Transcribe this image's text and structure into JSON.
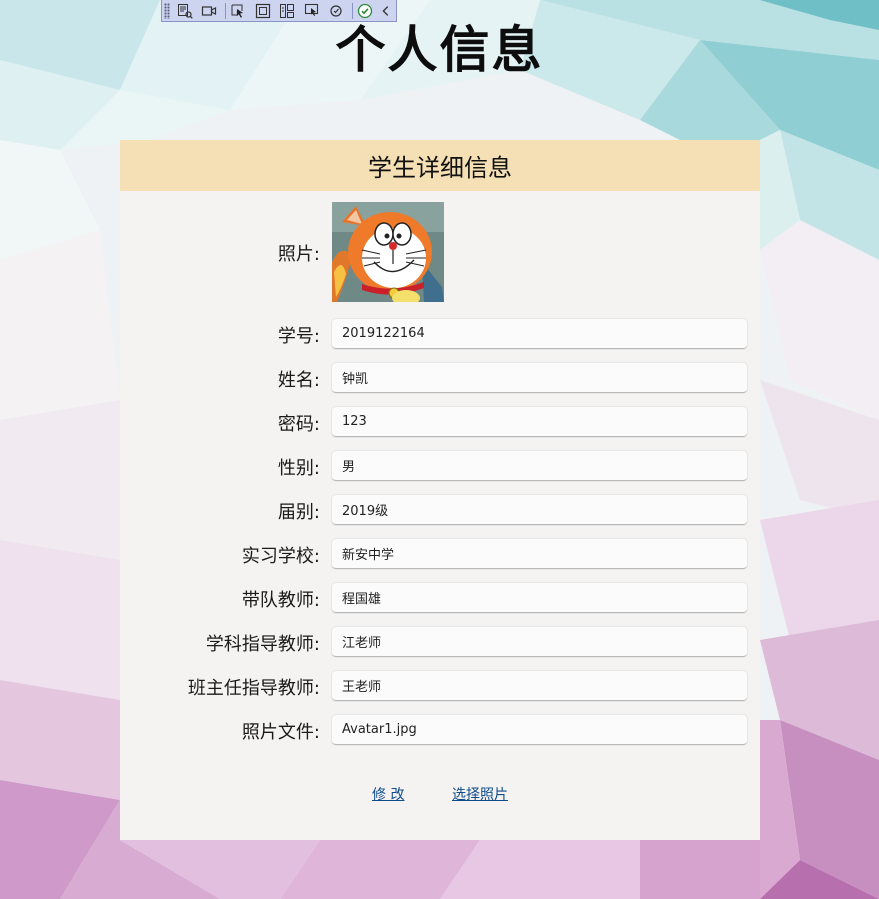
{
  "page": {
    "title": "个人信息"
  },
  "toolbar": {
    "tools": [
      {
        "icon": "select-element-icon"
      },
      {
        "icon": "record-icon"
      },
      {
        "icon": "pointer-select-icon"
      },
      {
        "icon": "layout-adorner-icon"
      },
      {
        "icon": "display-layout-icon"
      },
      {
        "icon": "track-focus-icon"
      },
      {
        "icon": "binding-failures-icon"
      },
      {
        "icon": "hot-reload-check-icon"
      },
      {
        "icon": "collapse-chevron-icon"
      }
    ]
  },
  "card": {
    "header": "学生详细信息",
    "photo_label": "照片:",
    "fields": [
      {
        "label": "学号:",
        "value": "2019122164"
      },
      {
        "label": "姓名:",
        "value": "钟凯"
      },
      {
        "label": "密码:",
        "value": "123"
      },
      {
        "label": "性别:",
        "value": "男"
      },
      {
        "label": "届别:",
        "value": "2019级"
      },
      {
        "label": "实习学校:",
        "value": "新安中学"
      },
      {
        "label": "带队教师:",
        "value": "程国雄"
      },
      {
        "label": "学科指导教师:",
        "value": "江老师"
      },
      {
        "label": "班主任指导教师:",
        "value": "王老师"
      },
      {
        "label": "照片文件:",
        "value": "Avatar1.jpg"
      }
    ],
    "actions": {
      "edit": "修 改",
      "choose_photo": "选择照片"
    }
  },
  "colors": {
    "header_bg": "#f5dfb4",
    "card_bg": "#f4f3f1",
    "link": "#0e4c8c",
    "toolbar_bg": "#cdd4f0"
  }
}
